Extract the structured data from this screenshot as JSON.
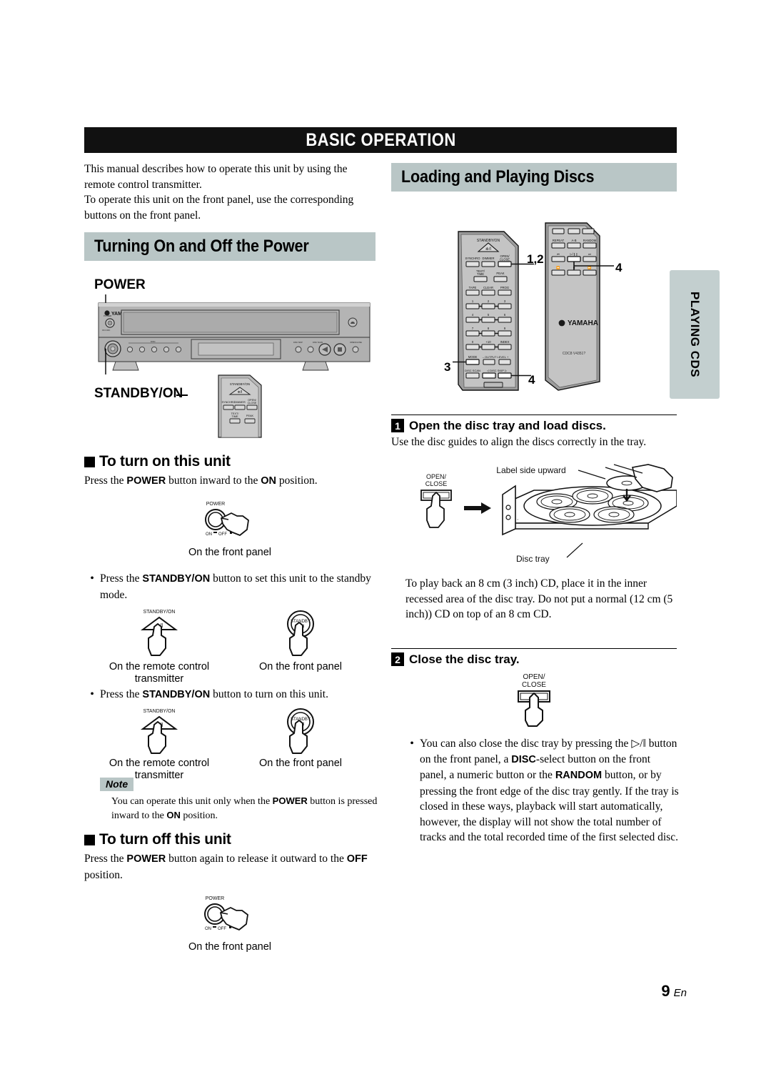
{
  "banner": {
    "title": "BASIC OPERATION"
  },
  "intro": {
    "paragraph": "This manual describes how to operate this unit by using the remote control transmitter.",
    "paragraph2": "To operate this unit on the front panel, use the corresponding buttons on the front panel."
  },
  "left": {
    "section_title": "Turning On and Off the Power",
    "label_power": "POWER",
    "label_standby": "STANDBY/ON",
    "turn_on": {
      "heading": "To turn on this unit",
      "text_pre": "Press the ",
      "text_b1": "POWER",
      "text_mid": " button inward to the ",
      "text_b2": "ON",
      "text_post": " position.",
      "caption": "On the front panel",
      "icon_label": "POWER",
      "icon_on": "ON",
      "icon_off": "OFF"
    },
    "bullet1": {
      "pre": "Press the ",
      "bold": "STANDBY/ON",
      "post": " button to set this unit to the standby mode.",
      "caption_remote": "On the remote control transmitter",
      "caption_front": "On the front panel",
      "icon_label": "STANDBY/ON",
      "front_label_1": "STANDBY",
      "front_label_2": "/ON"
    },
    "bullet2": {
      "pre": "Press the ",
      "bold": "STANDBY/ON",
      "post": " button to turn on this unit.",
      "caption_remote": "On the remote control transmitter",
      "caption_front": "On the front panel",
      "icon_label": "STANDBY/ON",
      "front_label_1": "STANDBY",
      "front_label_2": "/ON"
    },
    "note": {
      "tag": "Note",
      "pre": "You can operate this unit only when the ",
      "b1": "POWER",
      "mid": " button is pressed inward to the ",
      "b2": "ON",
      "post": " position."
    },
    "turn_off": {
      "heading": "To turn off this unit",
      "pre": "Press the ",
      "b1": "POWER",
      "mid": " button again to release it outward to the ",
      "b2": "OFF",
      "post": " position.",
      "caption": "On the front panel",
      "icon_label": "POWER",
      "icon_on": "ON",
      "icon_off": "OFF"
    },
    "front_panel": {
      "brand": "YAMAHA",
      "model_text": "NATURAL SOUND COMPACT DISC PLAYER CDC-581"
    }
  },
  "right": {
    "section_title": "Loading and Playing Discs",
    "remote": {
      "brand": "YAMAHA",
      "model": "CDC8  V4351?",
      "standby_label": "STANDBY/ON",
      "buttons_row1": [
        "SYNCHRO",
        "DIMMER",
        "OPEN/\nCLOSE"
      ],
      "buttons_row2": [
        "TEXT/\nTIME",
        "PEAK"
      ],
      "buttons_row3": [
        "TAPE",
        "CLEAR",
        "PROG"
      ],
      "numeric": [
        "1",
        "2",
        "3",
        "4",
        "5",
        "6",
        "7",
        "8",
        "9",
        "0",
        "+10",
        "INDEX"
      ],
      "buttons_mode": [
        "MODE",
        "OUTPUT LEVEL"
      ],
      "buttons_bottom": [
        "DISC SCAN",
        "DISC SKIP"
      ],
      "right_panel_row1": [
        "REPEAT",
        "A-B",
        "RANDOM"
      ],
      "callouts": [
        "1,2",
        "3",
        "4",
        "4"
      ]
    },
    "step1": {
      "num": "1",
      "title": "Open the disc tray and load discs.",
      "text": "Use the disc guides to align the discs correctly in the tray.",
      "label_side": "Label side upward",
      "label_tray": "Disc tray",
      "btn_open": "OPEN/",
      "btn_close": "CLOSE",
      "paragraph": "To play back an 8 cm (3 inch) CD, place it in the inner recessed area of the disc tray. Do not put a normal (12 cm (5 inch)) CD on top of an 8 cm CD."
    },
    "step2": {
      "num": "2",
      "title": "Close the disc tray.",
      "btn_open": "OPEN/",
      "btn_close": "CLOSE",
      "bullet": {
        "p1": "You can also close the disc tray by pressing the ",
        "glyph": "▷/‖",
        "p2": " button on the front panel, a ",
        "b1": "DISC",
        "p3": "-select button on the front panel, a numeric button or the ",
        "b2": "RANDOM",
        "p4": " button, or by pressing the front edge of the disc tray gently. If the tray is closed in these ways, playback will start automatically, however, the display will not show the total number of tracks and the total recorded time of the first selected disc."
      }
    }
  },
  "side_tab": {
    "label": "PLAYING CDS"
  },
  "footer": {
    "page_number": "9",
    "lang": "En"
  },
  "colors": {
    "banner_bg": "#111111",
    "header_bg": "#b9c6c6",
    "device_body": "#a8a8a8",
    "device_light": "#c8c8c8"
  }
}
